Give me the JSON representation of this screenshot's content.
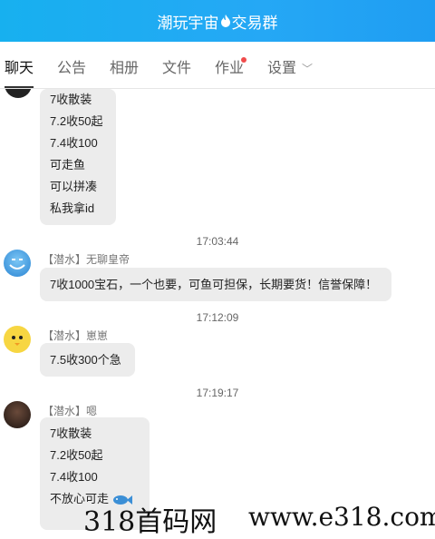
{
  "header": {
    "title_left": "潮玩宇宙",
    "title_right": "交易群",
    "icon": "flame-icon"
  },
  "tabs": [
    {
      "label": "聊天"
    },
    {
      "label": "公告"
    },
    {
      "label": "相册"
    },
    {
      "label": "文件"
    },
    {
      "label": "作业"
    },
    {
      "label": "设置"
    }
  ],
  "messages": [
    {
      "lines": [
        "7收散装",
        "7.2收50起",
        "7.4收100",
        "可走鱼",
        "可以拼凑",
        "私我拿id"
      ]
    },
    {
      "time": "17:03:44",
      "tag": "【潜水】",
      "name": "无聊皇帝",
      "lines": [
        "7收1000宝石，一个也要，可鱼可担保，长期要货！信誉保障！"
      ]
    },
    {
      "time": "17:12:09",
      "tag": "【潜水】",
      "name": "崽崽",
      "lines": [
        "7.5收300个急"
      ]
    },
    {
      "time": "17:19:17",
      "tag": "【潜水】",
      "name": "嗯",
      "lines": [
        "7收散装",
        "7.2收50起",
        "7.4收100",
        "不放心可走"
      ]
    }
  ],
  "watermark": {
    "left": "318首码网",
    "right": "www.e318.com"
  },
  "colors": {
    "header": "#1ea8f3",
    "bubble": "#ececec",
    "reddot": "#f04b4b"
  }
}
